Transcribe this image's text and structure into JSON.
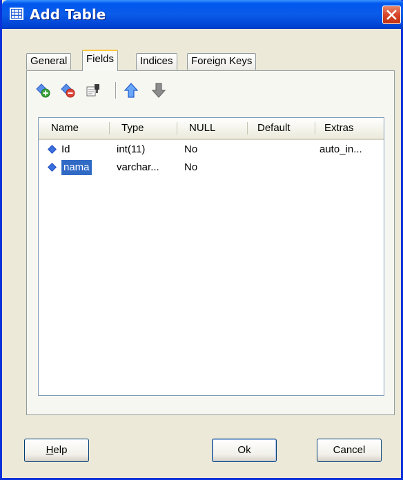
{
  "window": {
    "title": "Add Table"
  },
  "tabs": [
    {
      "label": "General"
    },
    {
      "label": "Fields",
      "active": true
    },
    {
      "label": "Indices"
    },
    {
      "label": "Foreign Keys"
    }
  ],
  "toolbar": {
    "icons": [
      "add-field-icon",
      "remove-field-icon",
      "edit-field-icon",
      "move-up-icon",
      "move-down-icon"
    ]
  },
  "fields": {
    "columns": [
      "Name",
      "Type",
      "NULL",
      "Default",
      "Extras"
    ],
    "rows": [
      {
        "name": "Id",
        "type": "int(11)",
        "null": "No",
        "default": "",
        "extras": "auto_in..."
      },
      {
        "name": "nama",
        "type": "varchar...",
        "null": "No",
        "default": "",
        "extras": "",
        "selected": true
      }
    ]
  },
  "buttons": {
    "help": "Help",
    "help_mnemonic": "H",
    "help_rest": "elp",
    "ok": "Ok",
    "cancel": "Cancel"
  },
  "colors": {
    "titlebar": "#0058EE",
    "selection": "#316AC5",
    "dialog_bg": "#ECE9D8"
  }
}
